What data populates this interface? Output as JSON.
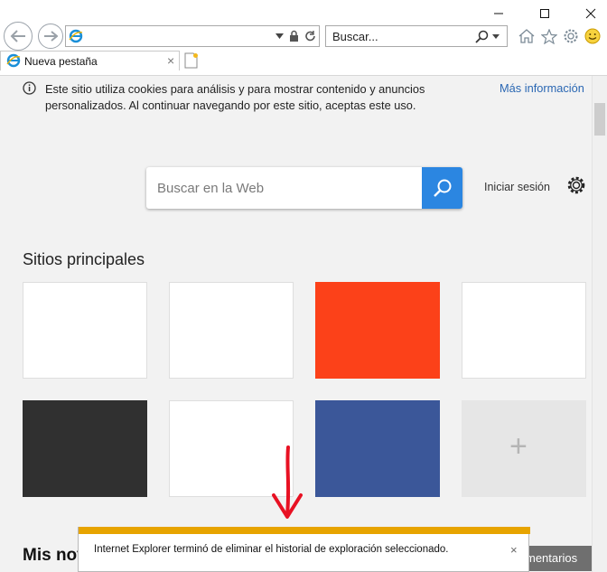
{
  "window": {
    "controls": [
      "minimize",
      "maximize",
      "close"
    ]
  },
  "nav": {
    "address_value": "",
    "search_placeholder": "Buscar...",
    "toolbar_icons": [
      "home-icon",
      "star-icon",
      "gear-icon",
      "smiley-icon"
    ]
  },
  "tab": {
    "title": "Nueva pestaña",
    "close": "×"
  },
  "cookie": {
    "message": "Este sitio utiliza cookies para análisis y para mostrar contenido y anuncios personalizados. Al continuar navegando por este sitio, aceptas este uso.",
    "link": "Más información"
  },
  "search": {
    "placeholder": "Buscar en la Web",
    "signin": "Iniciar sesión"
  },
  "top_sites": {
    "title": "Sitios principales",
    "tiles": [
      {
        "color": "#ffffff"
      },
      {
        "color": "#ffffff"
      },
      {
        "color": "#fc4119"
      },
      {
        "color": "#ffffff"
      },
      {
        "color": "#303030"
      },
      {
        "color": "#ffffff"
      },
      {
        "color": "#3b5799"
      },
      {
        "color": "#e6e6e6",
        "add": true
      }
    ],
    "add_symbol": "+"
  },
  "news": {
    "title": "Mis not",
    "feedback_label": "mentarios"
  },
  "notification": {
    "message": "Internet Explorer terminó de eliminar el historial de exploración seleccionado.",
    "close": "×"
  },
  "annotation": {
    "color": "#e81123"
  }
}
